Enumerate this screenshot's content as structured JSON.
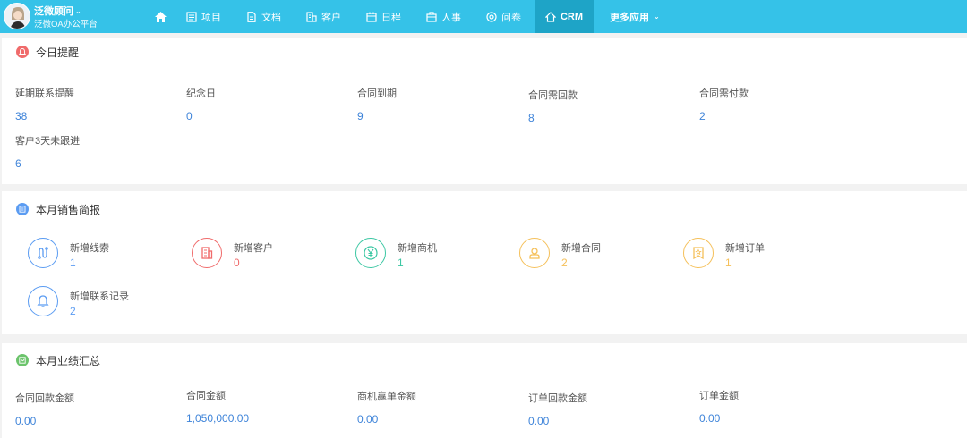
{
  "colors": {
    "topbar": "#35c2e8",
    "active_tab": "#1ea4c7",
    "link_value": "#3f84d9",
    "reminder_icon": "#f06b6b",
    "sales_icon": "#5b9cf2",
    "performance_icon": "#6cc46c",
    "blue": "#5b9cf2",
    "red": "#f06b6b",
    "green": "#3cc7a3",
    "orange": "#f5c05a"
  },
  "brand": {
    "name": "泛微顾问",
    "subtitle": "泛微OA办公平台",
    "avatar_icon": "user-avatar"
  },
  "nav": {
    "home_icon": "home-icon",
    "items": [
      {
        "label": "项目",
        "icon": "project-icon"
      },
      {
        "label": "文档",
        "icon": "document-icon"
      },
      {
        "label": "客户",
        "icon": "customer-icon"
      },
      {
        "label": "日程",
        "icon": "calendar-icon"
      },
      {
        "label": "人事",
        "icon": "hr-icon"
      },
      {
        "label": "问卷",
        "icon": "survey-icon"
      },
      {
        "label": "CRM",
        "icon": "crm-icon",
        "active": true
      },
      {
        "label": "更多应用",
        "icon": "chevron-down-icon"
      }
    ]
  },
  "reminders": {
    "title": "今日提醒",
    "icon": "bell-icon",
    "items": [
      {
        "label": "延期联系提醒",
        "value": "38"
      },
      {
        "label": "纪念日",
        "value": "0"
      },
      {
        "label": "合同到期",
        "value": "9"
      },
      {
        "label": "合同需回款",
        "value": "8"
      },
      {
        "label": "合同需付款",
        "value": "2"
      },
      {
        "label": "客户3天未跟进",
        "value": "6"
      }
    ]
  },
  "sales": {
    "title": "本月销售简报",
    "icon": "report-icon",
    "items": [
      {
        "label": "新增线索",
        "value": "1",
        "icon": "lead-icon",
        "color": "#5b9cf2"
      },
      {
        "label": "新增客户",
        "value": "0",
        "icon": "building-icon",
        "color": "#f06b6b"
      },
      {
        "label": "新增商机",
        "value": "1",
        "icon": "yen-icon",
        "color": "#3cc7a3"
      },
      {
        "label": "新增合同",
        "value": "2",
        "icon": "contract-icon",
        "color": "#f5c05a"
      },
      {
        "label": "新增订单",
        "value": "1",
        "icon": "order-icon",
        "color": "#f5c05a"
      },
      {
        "label": "新增联系记录",
        "value": "2",
        "icon": "bell-icon",
        "color": "#5b9cf2"
      }
    ]
  },
  "performance": {
    "title": "本月业绩汇总",
    "icon": "chart-icon",
    "items": [
      {
        "label": "合同回款金额",
        "value": "0.00"
      },
      {
        "label": "合同金额",
        "value": "1,050,000.00"
      },
      {
        "label": "商机赢单金额",
        "value": "0.00"
      },
      {
        "label": "订单回款金额",
        "value": "0.00"
      },
      {
        "label": "订单金额",
        "value": "0.00"
      }
    ]
  }
}
